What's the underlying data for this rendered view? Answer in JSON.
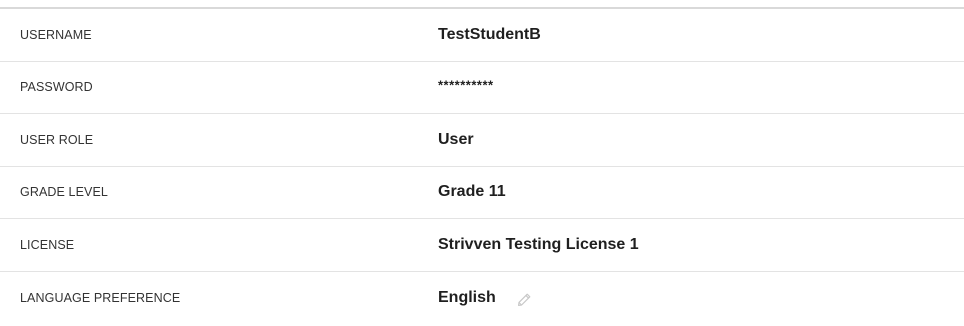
{
  "profile": {
    "rows": [
      {
        "label": "USERNAME",
        "value": "TestStudentB"
      },
      {
        "label": "PASSWORD",
        "value": "**********"
      },
      {
        "label": "USER ROLE",
        "value": "User"
      },
      {
        "label": "GRADE LEVEL",
        "value": "Grade 11"
      },
      {
        "label": "LICENSE",
        "value": "Strivven Testing License 1"
      },
      {
        "label": "LANGUAGE PREFERENCE",
        "value": "English",
        "action_icon": "pencil-icon"
      }
    ]
  },
  "colors": {
    "divider": "#e3e3e3",
    "top_border": "#d9d9d9",
    "label_text": "#333333",
    "value_text": "#1f1f1f",
    "icon": "#c8c8c8"
  }
}
